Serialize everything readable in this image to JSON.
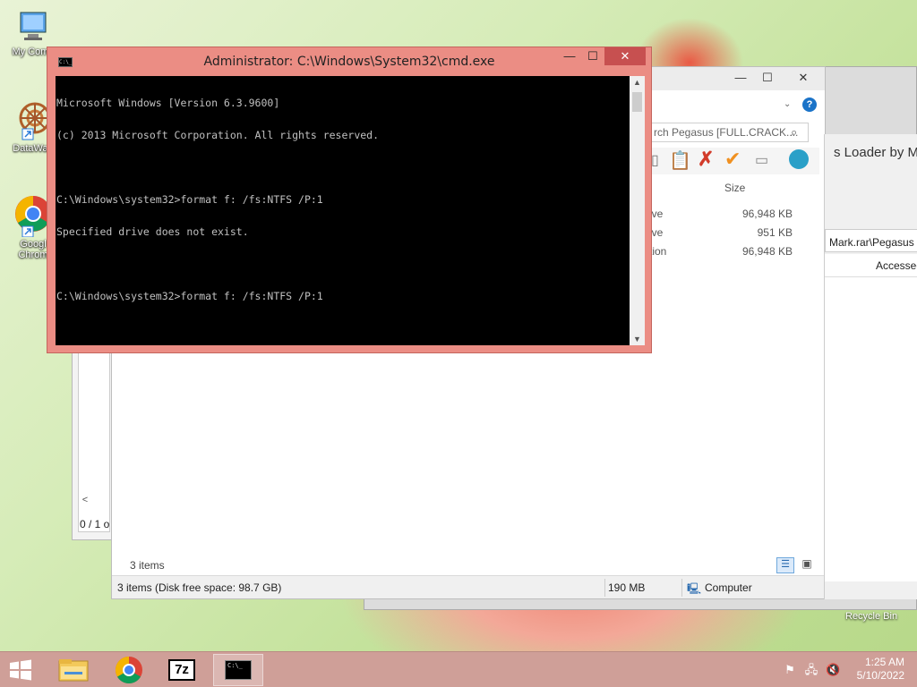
{
  "desktop": {
    "icons": [
      {
        "label": "My Comp"
      },
      {
        "label": "DataWag"
      },
      {
        "label": "Googl Chrom"
      }
    ],
    "recycle_bin": "Recycle Bin"
  },
  "explorer": {
    "search_placeholder": "rch Pegasus [FULL.CRACK....",
    "column_size": "Size",
    "rows": [
      {
        "type": "ive",
        "size": "96,948 KB"
      },
      {
        "type": "ive",
        "size": "951 KB"
      },
      {
        "type": "tion",
        "size": "96,948 KB"
      }
    ],
    "item_count": "3 items",
    "status_items": "3 items (Disk free space: 98.7 GB)",
    "status_size": "190 MB",
    "status_location": "Computer",
    "left_status": "0 / 1 o"
  },
  "back_window": {
    "title_fragment": "s Loader by Mar",
    "path_fragment": "Mark.rar\\Pegasus L",
    "column_accessed": "Accessed"
  },
  "cmd": {
    "title": "Administrator: C:\\Windows\\System32\\cmd.exe",
    "icon_text": "C:\\_",
    "lines": [
      "Microsoft Windows [Version 6.3.9600]",
      "(c) 2013 Microsoft Corporation. All rights reserved.",
      "",
      "C:\\Windows\\system32>format f: /fs:NTFS /P:1",
      "Specified drive does not exist.",
      "",
      "C:\\Windows\\system32>format f: /fs:NTFS /P:1"
    ]
  },
  "taskbar": {
    "time": "1:25 AM",
    "date": "5/10/2022",
    "sevenzip_label": "7z",
    "cmd_label": "C:\\_"
  },
  "colors": {
    "cmd_frame": "#eb8d84",
    "taskbar": "#cf9f98",
    "close_button": "#c75050"
  }
}
